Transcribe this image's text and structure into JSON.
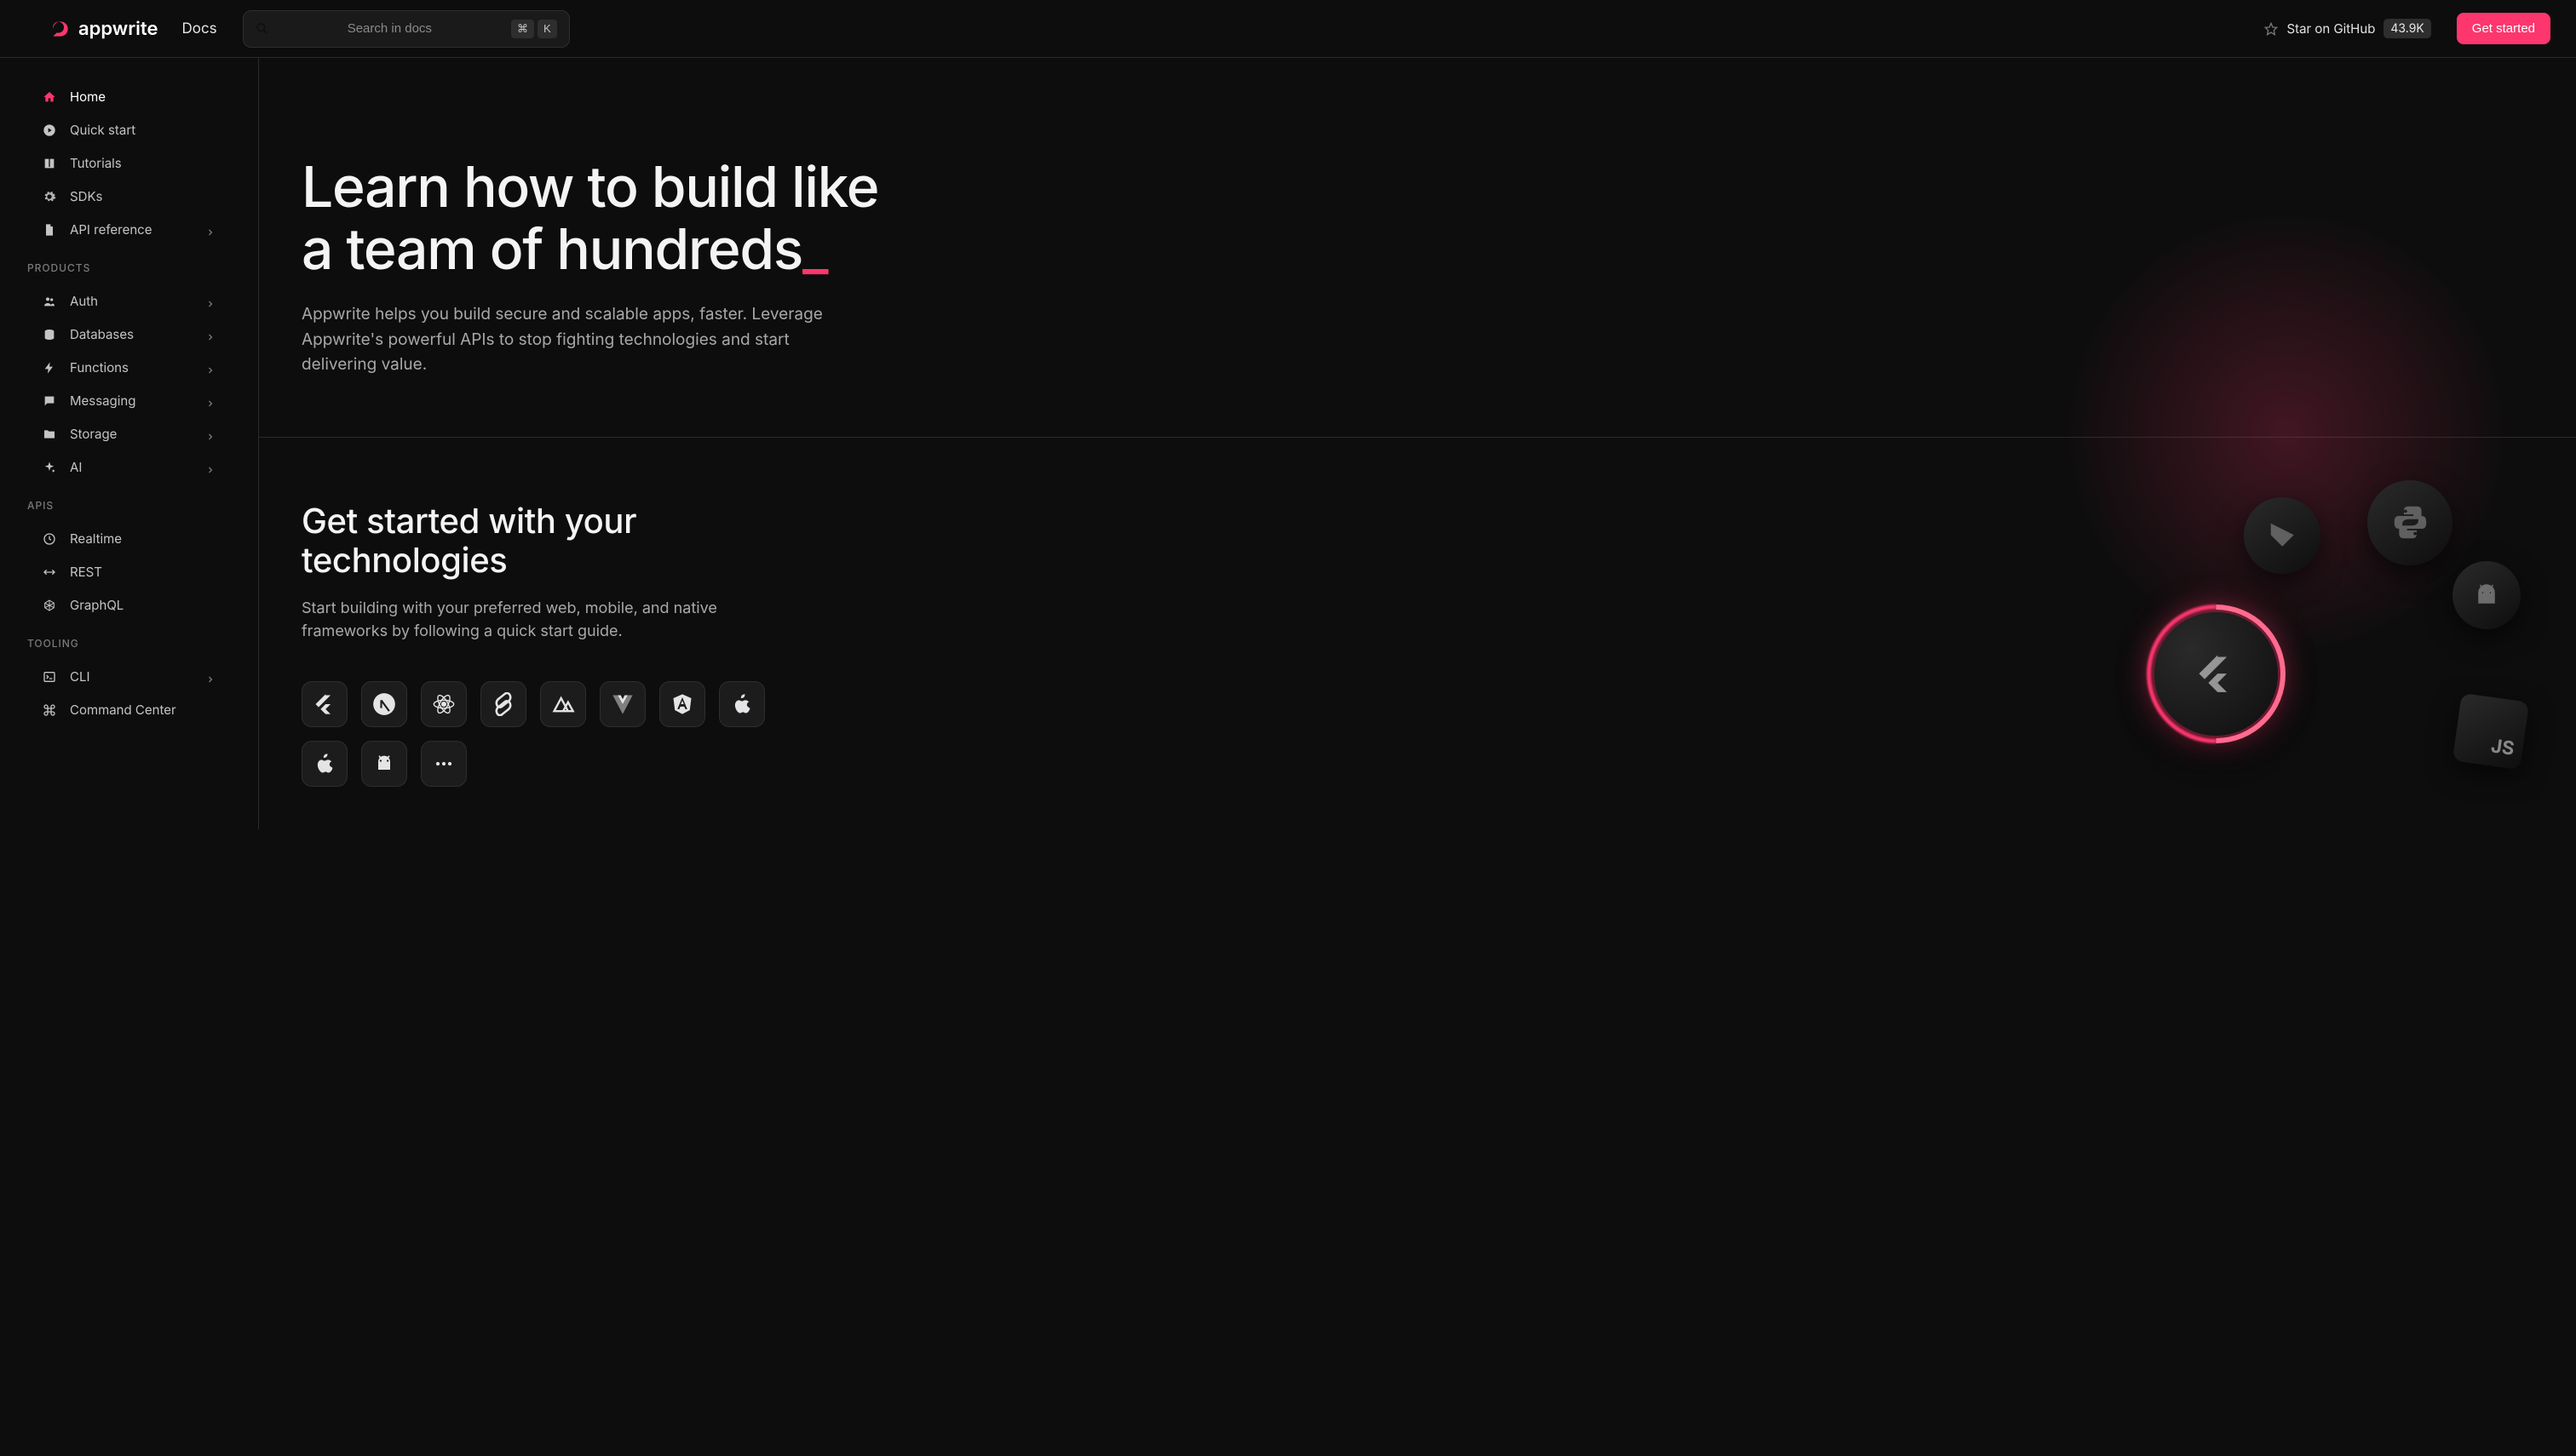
{
  "header": {
    "logo": "appwrite",
    "docs_link": "Docs",
    "search_placeholder": "Search in docs",
    "kbd_cmd": "⌘",
    "kbd_k": "K",
    "github_label": "Star on GitHub",
    "github_stars": "43.9K",
    "cta": "Get started"
  },
  "sidebar": {
    "main": [
      {
        "label": "Home",
        "icon": "home",
        "active": true,
        "chevron": false
      },
      {
        "label": "Quick start",
        "icon": "play",
        "chevron": false
      },
      {
        "label": "Tutorials",
        "icon": "book",
        "chevron": false
      },
      {
        "label": "SDKs",
        "icon": "gear",
        "chevron": false
      },
      {
        "label": "API reference",
        "icon": "file",
        "chevron": true
      }
    ],
    "sections": [
      {
        "heading": "PRODUCTS",
        "items": [
          {
            "label": "Auth",
            "icon": "users",
            "chevron": true
          },
          {
            "label": "Databases",
            "icon": "database",
            "chevron": true
          },
          {
            "label": "Functions",
            "icon": "bolt",
            "chevron": true
          },
          {
            "label": "Messaging",
            "icon": "message",
            "chevron": true
          },
          {
            "label": "Storage",
            "icon": "folder",
            "chevron": true
          },
          {
            "label": "AI",
            "icon": "sparkle",
            "chevron": true
          }
        ]
      },
      {
        "heading": "APIS",
        "items": [
          {
            "label": "Realtime",
            "icon": "clock",
            "chevron": false
          },
          {
            "label": "REST",
            "icon": "arrows",
            "chevron": false
          },
          {
            "label": "GraphQL",
            "icon": "graphql",
            "chevron": false
          }
        ]
      },
      {
        "heading": "TOOLING",
        "items": [
          {
            "label": "CLI",
            "icon": "terminal",
            "chevron": true
          },
          {
            "label": "Command Center",
            "icon": "command",
            "chevron": false
          }
        ]
      }
    ]
  },
  "hero": {
    "title_line1": "Learn how to build like",
    "title_line2": "a team of hundreds",
    "cursor": "_",
    "subtitle": "Appwrite helps you build secure and scalable apps, faster. Leverage Appwrite's powerful APIs to stop fighting technologies and start delivering value."
  },
  "tech": {
    "title": "Get started with your technologies",
    "subtitle": "Start building with your preferred web, mobile, and native frameworks by following a quick start guide.",
    "cards": [
      "flutter",
      "next",
      "react",
      "svelte",
      "nuxt",
      "vue",
      "angular",
      "apple",
      "apple",
      "android",
      "more"
    ]
  }
}
